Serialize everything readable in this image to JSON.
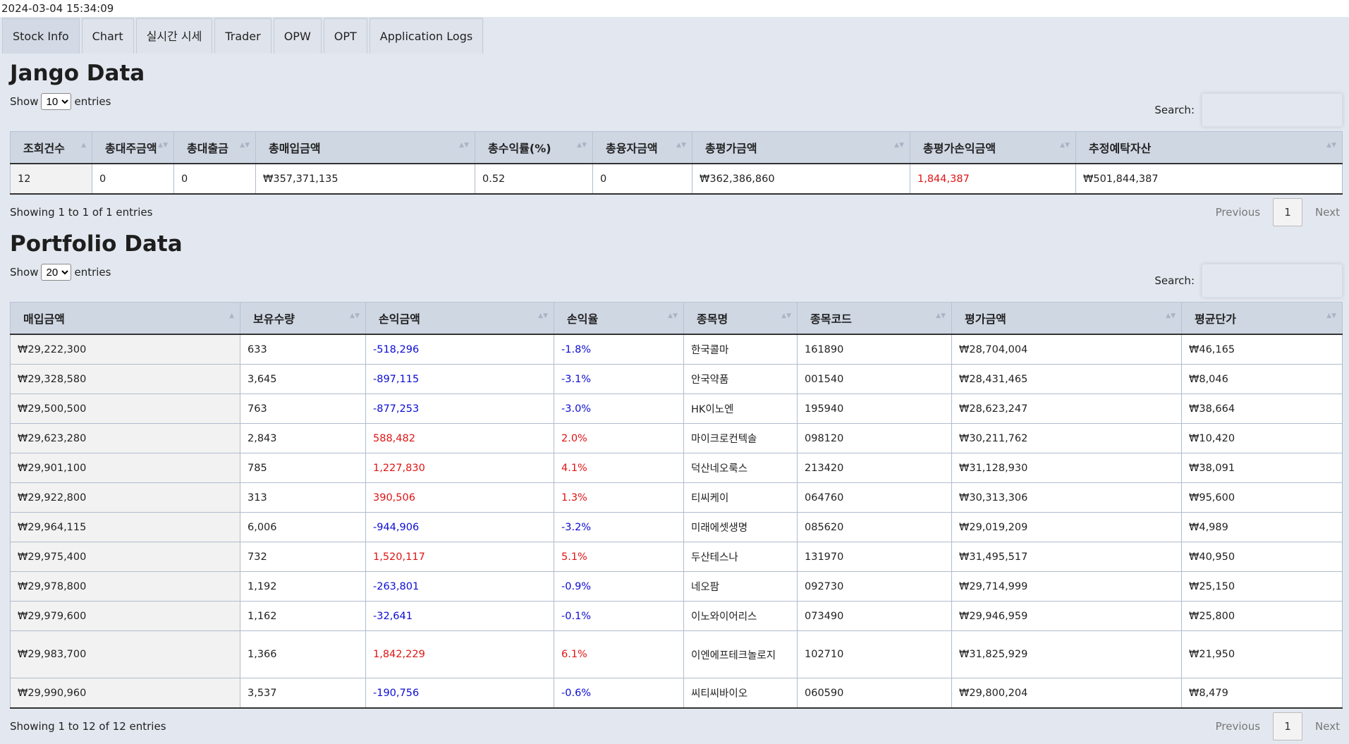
{
  "timestamp": "2024-03-04 15:34:09",
  "tabs": [
    "Stock Info",
    "Chart",
    "실시간 시세",
    "Trader",
    "OPW",
    "OPT",
    "Application Logs"
  ],
  "jango": {
    "title": "Jango Data",
    "show_label": "Show",
    "entries_label": "entries",
    "length": "10",
    "search_label": "Search:",
    "columns": [
      "조회건수",
      "총대주금액",
      "총대출금",
      "총매입금액",
      "총수익률(%)",
      "총융자금액",
      "총평가금액",
      "총평가손익금액",
      "추정예탁자산"
    ],
    "row": [
      "12",
      "0",
      "0",
      "₩357,371,135",
      "0.52",
      "0",
      "₩362,386,860",
      "1,844,387",
      "₩501,844,387"
    ],
    "info": "Showing 1 to 1 of 1 entries",
    "prev": "Previous",
    "page": "1",
    "next": "Next"
  },
  "portfolio": {
    "title": "Portfolio Data",
    "show_label": "Show",
    "entries_label": "entries",
    "length": "20",
    "search_label": "Search:",
    "columns": [
      "매입금액",
      "보유수량",
      "손익금액",
      "손익율",
      "종목명",
      "종목코드",
      "평가금액",
      "평균단가"
    ],
    "rows": [
      [
        "₩29,222,300",
        "633",
        "-518,296",
        "-1.8%",
        "한국콜마",
        "161890",
        "₩28,704,004",
        "₩46,165"
      ],
      [
        "₩29,328,580",
        "3,645",
        "-897,115",
        "-3.1%",
        "안국약품",
        "001540",
        "₩28,431,465",
        "₩8,046"
      ],
      [
        "₩29,500,500",
        "763",
        "-877,253",
        "-3.0%",
        "HK이노엔",
        "195940",
        "₩28,623,247",
        "₩38,664"
      ],
      [
        "₩29,623,280",
        "2,843",
        "588,482",
        "2.0%",
        "마이크로컨텍솔",
        "098120",
        "₩30,211,762",
        "₩10,420"
      ],
      [
        "₩29,901,100",
        "785",
        "1,227,830",
        "4.1%",
        "덕산네오룩스",
        "213420",
        "₩31,128,930",
        "₩38,091"
      ],
      [
        "₩29,922,800",
        "313",
        "390,506",
        "1.3%",
        "티씨케이",
        "064760",
        "₩30,313,306",
        "₩95,600"
      ],
      [
        "₩29,964,115",
        "6,006",
        "-944,906",
        "-3.2%",
        "미래에셋생명",
        "085620",
        "₩29,019,209",
        "₩4,989"
      ],
      [
        "₩29,975,400",
        "732",
        "1,520,117",
        "5.1%",
        "두산테스나",
        "131970",
        "₩31,495,517",
        "₩40,950"
      ],
      [
        "₩29,978,800",
        "1,192",
        "-263,801",
        "-0.9%",
        "네오팜",
        "092730",
        "₩29,714,999",
        "₩25,150"
      ],
      [
        "₩29,979,600",
        "1,162",
        "-32,641",
        "-0.1%",
        "이노와이어리스",
        "073490",
        "₩29,946,959",
        "₩25,800"
      ],
      [
        "₩29,983,700",
        "1,366",
        "1,842,229",
        "6.1%",
        "이엔에프테크놀로지",
        "102710",
        "₩31,825,929",
        "₩21,950"
      ],
      [
        "₩29,990,960",
        "3,537",
        "-190,756",
        "-0.6%",
        "씨티씨바이오",
        "060590",
        "₩29,800,204",
        "₩8,479"
      ]
    ],
    "info": "Showing 1 to 12 of 12 entries",
    "prev": "Previous",
    "page": "1",
    "next": "Next"
  },
  "colors": {
    "negative": "#0b0bd6",
    "positive": "#e01414"
  }
}
